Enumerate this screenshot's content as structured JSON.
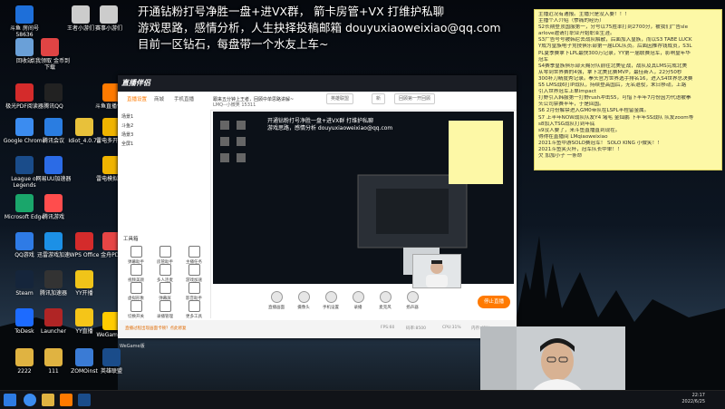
{
  "overlay": {
    "line1": "开通钻粉打号净胜一盘+进VX群，  箭卡房管+VX  打维护私聊",
    "line2": "游戏思路，感情分析，人生抉择投稿邮箱 douyuxiaoweixiao@qq.com",
    "line3": "目前一区钻石，每盘带一个水友上车~"
  },
  "desktop_icons": [
    {
      "label": "斗鱼 房间号 58636",
      "icon": "douyu-logo-icon",
      "color": "#1e6fd9"
    },
    {
      "label": "王者小游们",
      "icon": "document-icon",
      "color": "#cccccc"
    },
    {
      "label": "赛事小游们",
      "icon": "document-icon",
      "color": "#cccccc"
    },
    {
      "label": "回收站",
      "icon": "recycle-bin-icon",
      "color": "#6aa0d8"
    },
    {
      "label": "点我领取 金币到 下载",
      "icon": "gift-icon",
      "color": "#e04444"
    },
    {
      "label": "极光PDF阅读器",
      "icon": "pdf-icon",
      "color": "#d42b2b"
    },
    {
      "label": "腾讯QQ",
      "icon": "qq-icon",
      "color": "#222222"
    },
    {
      "label": "斗鱼直播伴侣",
      "icon": "douyu-live-icon",
      "color": "#ff7a00"
    },
    {
      "label": "Google Chrome",
      "icon": "chrome-icon",
      "color": "#3b8cf0"
    },
    {
      "label": "腾讯会议",
      "icon": "tencent-meeting-icon",
      "color": "#2a7de1"
    },
    {
      "label": "Idiot_4.0.78",
      "icon": "app-icon",
      "color": "#e8c13a"
    },
    {
      "label": "雷电多开器4",
      "icon": "thunder-emulator-icon",
      "color": "#f0b400"
    },
    {
      "label": "League of Legends",
      "icon": "lol-icon",
      "color": "#1a4c8a"
    },
    {
      "label": "网易UU加速器",
      "icon": "uu-icon",
      "color": "#2b6be6"
    },
    {
      "label": "雷电模拟器9",
      "icon": "thunder-emulator-icon",
      "color": "#f0b400"
    },
    {
      "label": "Microsoft Edge",
      "icon": "edge-icon",
      "color": "#1aa66b"
    },
    {
      "label": "腾讯游戏",
      "icon": "tencent-games-icon",
      "color": "#ff4d4d"
    },
    {
      "label": "QQ游戏",
      "icon": "qq-games-icon",
      "color": "#2e7be6"
    },
    {
      "label": "迅雷游戏加速",
      "icon": "thunder-accel-icon",
      "color": "#1c90e6"
    },
    {
      "label": "WPS Office",
      "icon": "wps-icon",
      "color": "#d42b2b"
    },
    {
      "label": "金舟PDF",
      "icon": "pdf-tool-icon",
      "color": "#e64545"
    },
    {
      "label": "Steam",
      "icon": "steam-icon",
      "color": "#15253b"
    },
    {
      "label": "腾讯加速器",
      "icon": "tencent-accel-icon",
      "color": "#333333"
    },
    {
      "label": "YY开播",
      "icon": "yy-icon",
      "color": "#f0c419"
    },
    {
      "label": "ToDesk",
      "icon": "todesk-icon",
      "color": "#1d6bff"
    },
    {
      "label": "Launcher",
      "icon": "launcher-icon",
      "color": "#b02525"
    },
    {
      "label": "YY直播",
      "icon": "yy-live-icon",
      "color": "#f5c518"
    },
    {
      "label": "2222",
      "icon": "folder-icon",
      "color": "#e0b341"
    },
    {
      "label": "111",
      "icon": "folder-icon",
      "color": "#e0b341"
    },
    {
      "label": "ZOMOinst",
      "icon": "zomo-icon",
      "color": "#3a7bd5"
    },
    {
      "label": "英雄联盟",
      "icon": "lol-cn-icon",
      "color": "#1a4c8a"
    },
    {
      "label": "WeGame版",
      "icon": "wegame-icon",
      "color": "#ffcc00"
    }
  ],
  "note": {
    "lines": [
      "主播近况有通报。主播只是没入要！！！",
      "主播个人介绍（惨痛的经历）",
      "S2长期登顶国服第一，分号以75胜率打到2700分，被我们广告sle",
      "arlove邀请打职业开始职业生涯。",
      "S3广告号号被韩尼去战队解散，后面加入皇族，而以S3 TABE LUCK",
      "Y成为皇族电子竞技俱乐部第一届LOL队员。后面因推荐钱成员，S3L",
      "PL夏季赛拿下LPL最快300万记录，YY第一届联赛冠军，影响皇年华",
      "冠军",
      "S4赛季皇族俱乐部天赐分队前往北美征战，战队及其LMS完成北美",
      "从零到世界赛的4强，拿下北美比赛MVP，最佳新人，22分50秒",
      "300补刀精度秀记录。拳头官方世界选手排名16，进入S4世界总决赛",
      "S5 LMS战6打IP战队，持续登高国后，无名退役，末日移动，上路",
      "引入世界冠军上单impact",
      "打野引入韩服第一打野rush冲击S5，可惜下半年7月份因为代语被拳",
      "头公司禁赛半年，于是回国。",
      "S6 2月份解禁进入GM0带队在LSPL半程留金属。",
      "S7 上半年NOW战队队友Y4 堵毛 金灿鹏 下半年SS战队 队友zoom等",
      "s8加入TSG战队打到年底",
      "s9没人要了，来斗鱼直播直到现在。",
      "得得在直播间  LMqiaoweixiao",
      "2021斗鱼中游SOLO赛冠军！  SOLO KING 小微笑！！",
      "2021斗鱼笑火杯，冠军队长中单！！",
      "欠    加加小子  一条命"
    ]
  },
  "obs": {
    "app_name": "直播伴侣",
    "tabs": [
      "直播设置",
      "商城",
      "手机直播"
    ],
    "room_title": "跟来五分钟上王者，回顾中单思路讲解~",
    "room_id": "LMQ--小微笑  15311",
    "pill_category": "英雄联盟",
    "pill_hosting": "新",
    "pill_notice": "回顾第一开回顾",
    "scenes": [
      "场景1",
      "斗鱼2",
      "场景3",
      "全屏1"
    ],
    "tools_title": "工具箱",
    "tools": [
      "弹幕助手",
      "房管助手",
      "主播任务",
      "视频美颜",
      "多人连麦",
      "游戏加速",
      "虚拟形象",
      "弹幕屏",
      "影音助手",
      "切换开关",
      "录播管理",
      "更多工具"
    ],
    "controls": [
      "直播画面",
      "摄像头",
      "手机设置",
      "录播",
      "麦克风",
      "扬声器"
    ],
    "live_button": "停止直播",
    "status": {
      "hint": "直播过程出现画面卡顿？点此修复",
      "fps": "FPS:60",
      "bitrate": "码率:8500",
      "cpu": "CPU:31%",
      "memory": "内存:43%"
    }
  },
  "bottom_caption": "WeGame版",
  "taskbar": {
    "time": "22:17",
    "date": "2022/6/25"
  },
  "colors": {
    "accent": "#ff7a00",
    "note_bg": "#fdf8a6",
    "sky_top": "#0a1220",
    "sky_mid": "#1c2a38"
  }
}
